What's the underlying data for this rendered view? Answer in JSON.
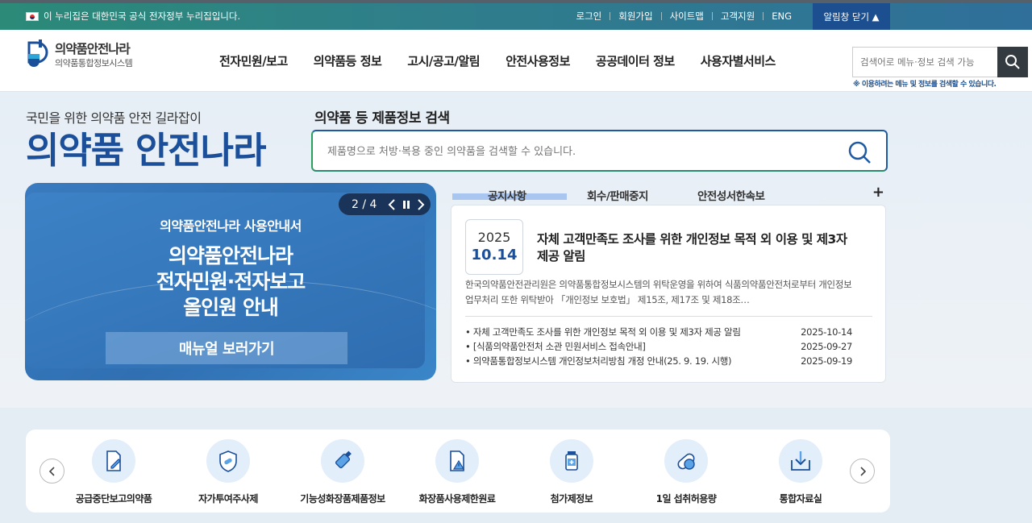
{
  "govbar": {
    "notice": "이 누리집은 대한민국 공식 전자정부 누리집입니다.",
    "links": [
      "로그인",
      "회원가입",
      "사이트맵",
      "고객지원",
      "ENG"
    ],
    "alert_toggle": "알림창 닫기 ▲"
  },
  "header": {
    "logo_title": "의약품안전나라",
    "logo_subtitle": "의약품통합정보시스템",
    "menus": [
      "전자민원/보고",
      "의약품등 정보",
      "고시/공고/알림",
      "안전사용정보",
      "공공데이터 정보",
      "사용자별서비스"
    ],
    "search_placeholder": "검색어로 메뉴·정보 검색 가능",
    "search_note": "※ 이용하려는 메뉴 및 정보를 검색할 수 있습니다."
  },
  "hero": {
    "slogan_sub": "국민을 위한 의약품 안전 길라잡이",
    "slogan_main": "의약품 안전나라",
    "product_search_title": "의약품 등 제품정보 검색",
    "product_search_placeholder": "제품명으로 처방·복용 중인 의약품을 검색할 수 있습니다."
  },
  "banner": {
    "sub": "의약품안전나라 사용안내서",
    "title_lines": [
      "의약품안전나라",
      "전자민원·전자보고",
      "올인원 안내"
    ],
    "cta": "매뉴얼 보러가기",
    "pager": "2 / 4"
  },
  "notices": {
    "tabs": [
      "공지사항",
      "회수/판매중지",
      "안전성서한속보"
    ],
    "plus": "+",
    "featured": {
      "year": "2025",
      "date": "10.14",
      "title": "자체 고객만족도 조사를 위한 개인정보 목적 외 이용 및 제3자 제공 알림",
      "desc": "한국의약품안전관리원은 의약품통합정보시스템의 위탁운영을 위하여 식품의약품안전처로부터 개인정보 업무처리 또한 위탁받아 「개인정보 보호법」 제15조, 제17조 및 제18조…"
    },
    "list": [
      {
        "title": "자체 고객만족도 조사를 위한 개인정보 목적 외 이용 및 제3자 제공 알림",
        "date": "2025-10-14"
      },
      {
        "title": "[식품의약품안전처 소관 민원서비스 접속안내]",
        "date": "2025-09-27"
      },
      {
        "title": "의약품통합정보시스템 개인정보처리방침 개정 안내(25. 9. 19. 시행)",
        "date": "2025-09-19"
      }
    ]
  },
  "quick_menu": [
    {
      "label": "공급중단보고의약품",
      "icon": "document-pen-icon"
    },
    {
      "label": "자가투여주사제",
      "icon": "shield-pill-icon"
    },
    {
      "label": "기능성화장품제품정보",
      "icon": "cosmetic-tube-icon"
    },
    {
      "label": "화장품사용제한원료",
      "icon": "document-warning-icon"
    },
    {
      "label": "첨가제정보",
      "icon": "medicine-bottle-icon"
    },
    {
      "label": "1일 섭취허용량",
      "icon": "capsule-icon"
    },
    {
      "label": "통합자료실",
      "icon": "download-archive-icon"
    }
  ]
}
